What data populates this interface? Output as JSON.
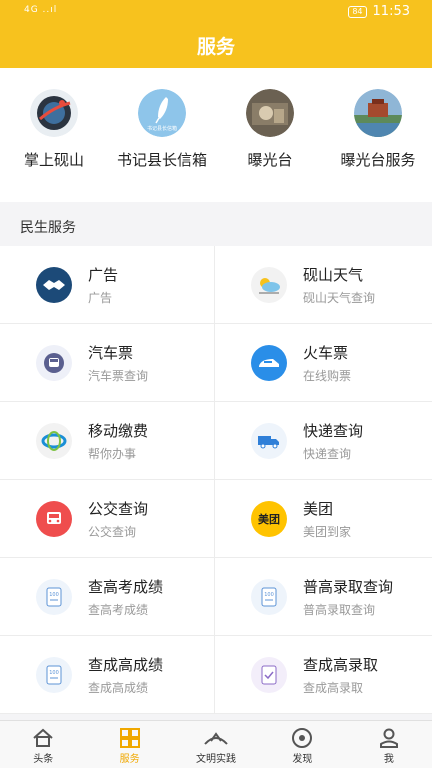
{
  "status": {
    "signal": "4G ..ıl",
    "battery": "84",
    "time": "11:53"
  },
  "header": {
    "title": "服务"
  },
  "quick_links": [
    {
      "label": "掌上砚山",
      "icon": "globe-icon"
    },
    {
      "label": "书记县长信箱",
      "icon": "quill-icon",
      "icon_text": "书记县长信箱"
    },
    {
      "label": "曝光台",
      "icon": "photo-icon"
    },
    {
      "label": "曝光台服务",
      "icon": "landscape-icon"
    }
  ],
  "section": {
    "title": "民生服务"
  },
  "services": [
    {
      "title": "广告",
      "sub": "广告",
      "icon": "handshake-icon",
      "color": "#1c4a78"
    },
    {
      "title": "砚山天气",
      "sub": "砚山天气查询",
      "icon": "weather-icon",
      "color": "#f2f2f2"
    },
    {
      "title": "汽车票",
      "sub": "汽车票查询",
      "icon": "bus-icon",
      "color": "#eef0f8"
    },
    {
      "title": "火车票",
      "sub": "在线购票",
      "icon": "train-icon",
      "color": "#2a8ee8"
    },
    {
      "title": "移动缴费",
      "sub": "帮你办事",
      "icon": "china-mobile-icon",
      "color": "#f2f2f2"
    },
    {
      "title": "快递查询",
      "sub": "快递查询",
      "icon": "truck-icon",
      "color": "#eef4fb"
    },
    {
      "title": "公交查询",
      "sub": "公交查询",
      "icon": "public-bus-icon",
      "color": "#ef4d4d"
    },
    {
      "title": "美团",
      "sub": "美团到家",
      "icon": "meituan-icon",
      "color": "#ffc300",
      "icon_text": "美团"
    },
    {
      "title": "查高考成绩",
      "sub": "查高考成绩",
      "icon": "score-sheet-icon",
      "color": "#eef4fb",
      "icon_text": "100"
    },
    {
      "title": "普高录取查询",
      "sub": "普高录取查询",
      "icon": "score-sheet-icon",
      "color": "#eef4fb",
      "icon_text": "100"
    },
    {
      "title": "查成高成绩",
      "sub": "查成高成绩",
      "icon": "score-sheet-icon",
      "color": "#eef4fb",
      "icon_text": "100"
    },
    {
      "title": "查成高录取",
      "sub": "查成高录取",
      "icon": "admission-check-icon",
      "color": "#f3eefa"
    }
  ],
  "tabs": [
    {
      "label": "头条",
      "icon": "home-icon",
      "active": false
    },
    {
      "label": "服务",
      "icon": "grid-icon",
      "active": true
    },
    {
      "label": "文明实践",
      "icon": "practice-icon",
      "active": false
    },
    {
      "label": "发现",
      "icon": "eye-icon",
      "active": false
    },
    {
      "label": "我",
      "icon": "person-icon",
      "active": false
    }
  ],
  "colors": {
    "accent": "#f7c21e",
    "active_tab": "#f0a800"
  }
}
